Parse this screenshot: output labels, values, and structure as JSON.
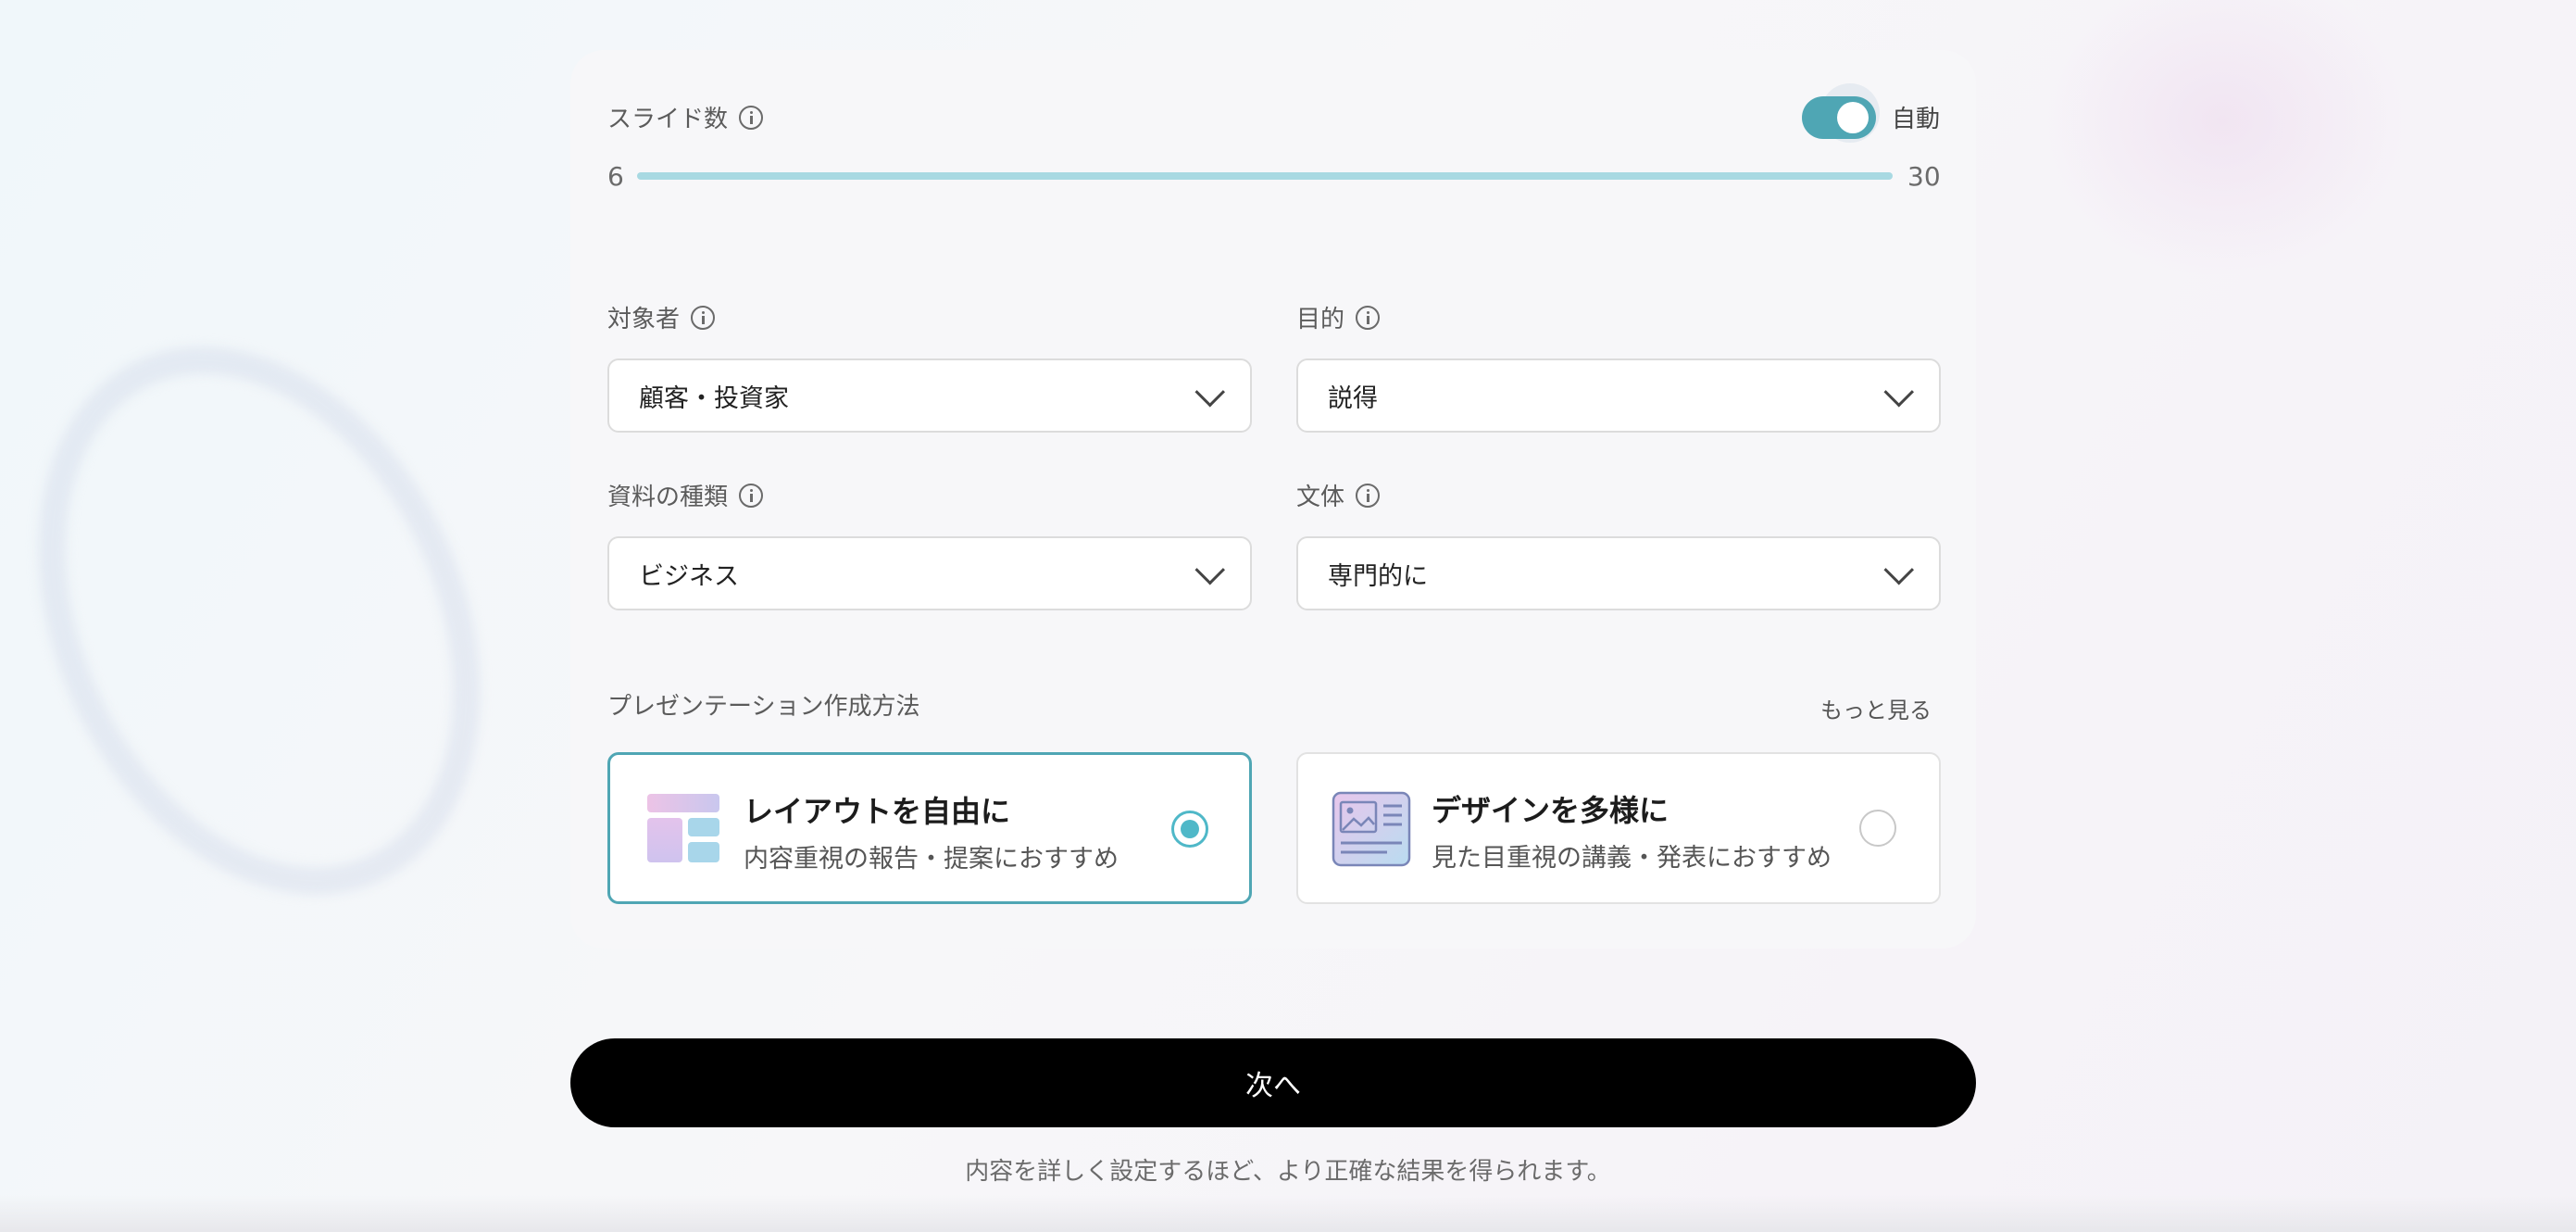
{
  "slides": {
    "label": "スライド数",
    "auto_label": "自動",
    "auto_enabled": true,
    "min": "6",
    "max": "30"
  },
  "audience": {
    "label": "対象者",
    "value": "顧客・投資家"
  },
  "purpose": {
    "label": "目的",
    "value": "説得"
  },
  "doc_type": {
    "label": "資料の種類",
    "value": "ビジネス"
  },
  "style": {
    "label": "文体",
    "value": "専門的に"
  },
  "method": {
    "label": "プレゼンテーション作成方法",
    "more_link": "もっと見る",
    "options": [
      {
        "title": "レイアウトを自由に",
        "desc": "内容重視の報告・提案におすすめ",
        "selected": true,
        "icon": "layout-icon"
      },
      {
        "title": "デザインを多様に",
        "desc": "見た目重視の講義・発表におすすめ",
        "selected": false,
        "icon": "image-layout-icon"
      }
    ]
  },
  "next_button": "次へ",
  "hint": "内容を詳しく設定するほど、より正確な結果を得られます。",
  "colors": {
    "accent": "#4fa6b4",
    "slider_track": "#a8d9e2",
    "button_bg": "#000000"
  }
}
